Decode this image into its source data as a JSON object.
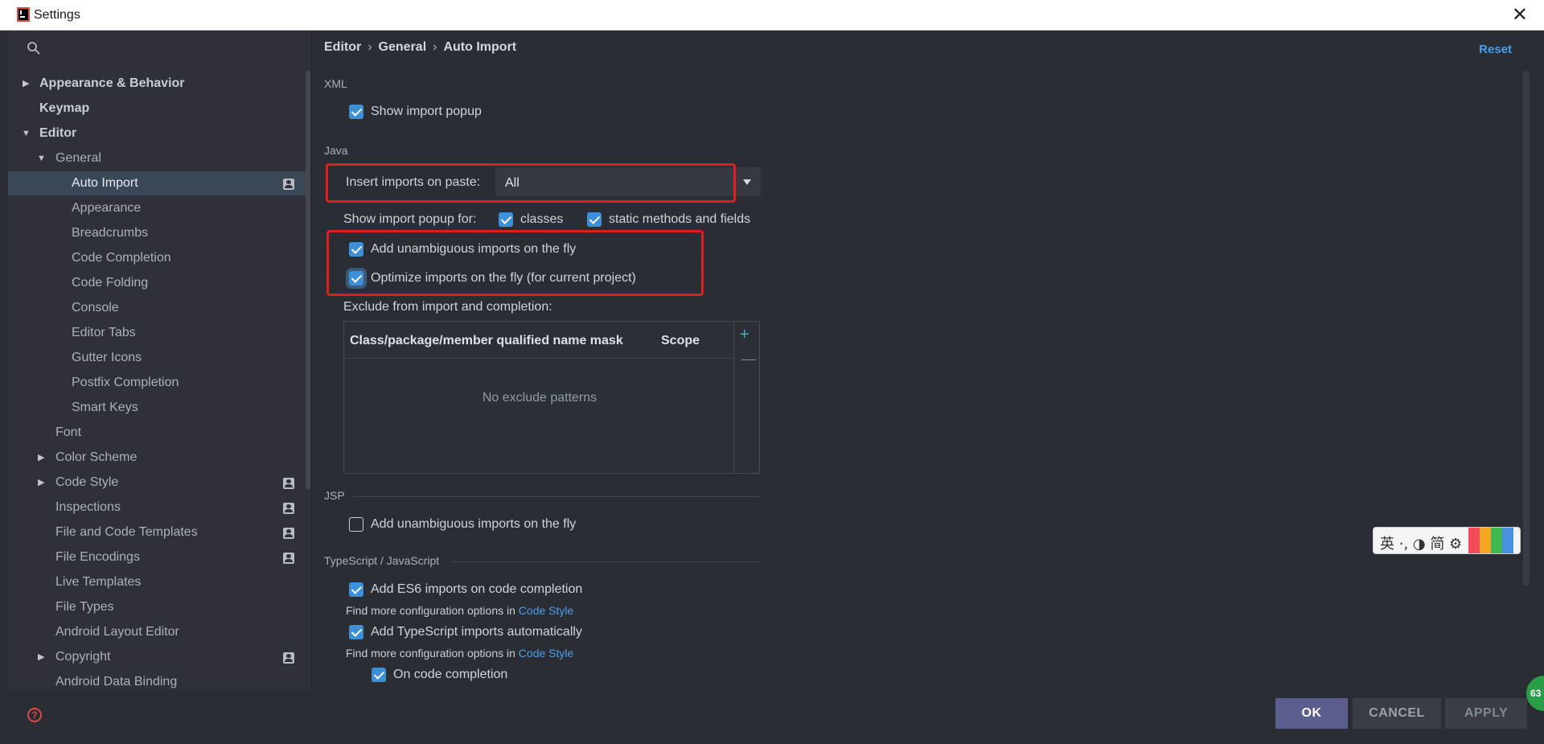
{
  "window": {
    "title": "Settings",
    "close_glyph": "✕"
  },
  "sidebar": {
    "search_icon": "search-icon",
    "items": [
      {
        "label": "Appearance & Behavior",
        "top": 0
      },
      {
        "label": "Keymap"
      },
      {
        "label": "Editor"
      },
      {
        "label": "General"
      },
      {
        "label": "Auto Import"
      },
      {
        "label": "Appearance"
      },
      {
        "label": "Breadcrumbs"
      },
      {
        "label": "Code Completion"
      },
      {
        "label": "Code Folding"
      },
      {
        "label": "Console"
      },
      {
        "label": "Editor Tabs"
      },
      {
        "label": "Gutter Icons"
      },
      {
        "label": "Postfix Completion"
      },
      {
        "label": "Smart Keys"
      },
      {
        "label": "Font"
      },
      {
        "label": "Color Scheme"
      },
      {
        "label": "Code Style"
      },
      {
        "label": "Inspections"
      },
      {
        "label": "File and Code Templates"
      },
      {
        "label": "File Encodings"
      },
      {
        "label": "Live Templates"
      },
      {
        "label": "File Types"
      },
      {
        "label": "Android Layout Editor"
      },
      {
        "label": "Copyright"
      },
      {
        "label": "Android Data Binding"
      }
    ]
  },
  "breadcrumb": {
    "part1": "Editor",
    "part2": "General",
    "part3": "Auto Import",
    "sep": "›"
  },
  "reset_label": "Reset",
  "xml": {
    "section": "XML",
    "show_import_popup": "Show import popup"
  },
  "java": {
    "section": "Java",
    "insert_imports_label": "Insert imports on paste:",
    "insert_imports_value": "All",
    "show_popup_for": "Show import popup for:",
    "classes": "classes",
    "static_methods": "static methods and fields",
    "add_unambiguous": "Add unambiguous imports on the fly",
    "optimize_imports": "Optimize imports on the fly (for current project)",
    "exclude_label": "Exclude from import and completion:",
    "table": {
      "col1": "Class/package/member qualified name mask",
      "col2": "Scope",
      "empty": "No exclude patterns",
      "plus": "+",
      "minus": "—"
    }
  },
  "jsp": {
    "section": "JSP",
    "add_unambiguous": "Add unambiguous imports on the fly"
  },
  "ts": {
    "section": "TypeScript / JavaScript",
    "add_es6": "Add ES6 imports on code completion",
    "find_more_1": "Find more configuration options in ",
    "code_style_link_1": "Code Style",
    "add_ts": "Add TypeScript imports automatically",
    "find_more_2": "Find more configuration options in ",
    "code_style_link_2": "Code Style",
    "on_completion": "On code completion"
  },
  "buttons": {
    "ok": "OK",
    "cancel": "CANCEL",
    "apply": "APPLY",
    "help": "?"
  },
  "ime": {
    "text": "英 ·, ◑ 简 ⚙"
  },
  "badge": {
    "text": "63"
  },
  "colors": {
    "accent": "#4a9ee8",
    "highlight_border": "#e01e1e",
    "ok_button": "#5b5e8c"
  }
}
